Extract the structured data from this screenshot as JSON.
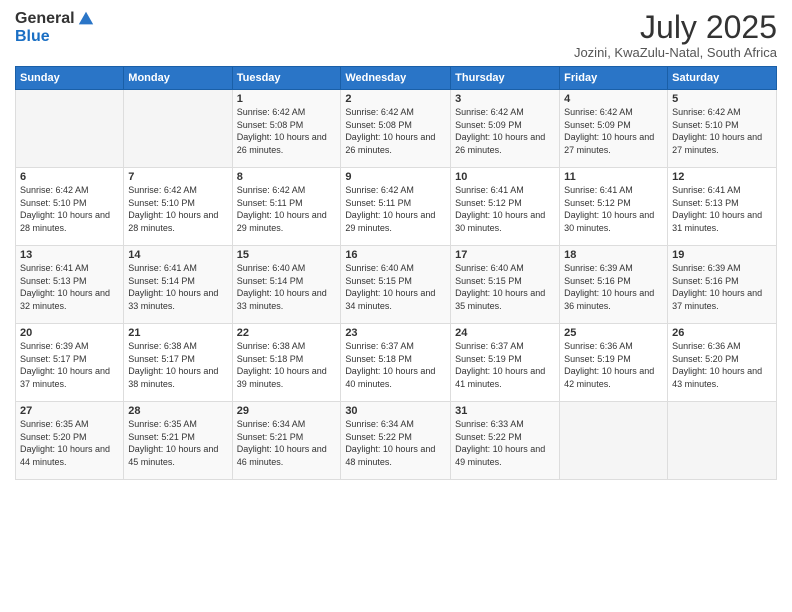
{
  "header": {
    "logo_general": "General",
    "logo_blue": "Blue",
    "title": "July 2025",
    "location": "Jozini, KwaZulu-Natal, South Africa"
  },
  "days_of_week": [
    "Sunday",
    "Monday",
    "Tuesday",
    "Wednesday",
    "Thursday",
    "Friday",
    "Saturday"
  ],
  "weeks": [
    [
      {
        "day": "",
        "sunrise": "",
        "sunset": "",
        "daylight": ""
      },
      {
        "day": "",
        "sunrise": "",
        "sunset": "",
        "daylight": ""
      },
      {
        "day": "1",
        "sunrise": "Sunrise: 6:42 AM",
        "sunset": "Sunset: 5:08 PM",
        "daylight": "Daylight: 10 hours and 26 minutes."
      },
      {
        "day": "2",
        "sunrise": "Sunrise: 6:42 AM",
        "sunset": "Sunset: 5:08 PM",
        "daylight": "Daylight: 10 hours and 26 minutes."
      },
      {
        "day": "3",
        "sunrise": "Sunrise: 6:42 AM",
        "sunset": "Sunset: 5:09 PM",
        "daylight": "Daylight: 10 hours and 26 minutes."
      },
      {
        "day": "4",
        "sunrise": "Sunrise: 6:42 AM",
        "sunset": "Sunset: 5:09 PM",
        "daylight": "Daylight: 10 hours and 27 minutes."
      },
      {
        "day": "5",
        "sunrise": "Sunrise: 6:42 AM",
        "sunset": "Sunset: 5:10 PM",
        "daylight": "Daylight: 10 hours and 27 minutes."
      }
    ],
    [
      {
        "day": "6",
        "sunrise": "Sunrise: 6:42 AM",
        "sunset": "Sunset: 5:10 PM",
        "daylight": "Daylight: 10 hours and 28 minutes."
      },
      {
        "day": "7",
        "sunrise": "Sunrise: 6:42 AM",
        "sunset": "Sunset: 5:10 PM",
        "daylight": "Daylight: 10 hours and 28 minutes."
      },
      {
        "day": "8",
        "sunrise": "Sunrise: 6:42 AM",
        "sunset": "Sunset: 5:11 PM",
        "daylight": "Daylight: 10 hours and 29 minutes."
      },
      {
        "day": "9",
        "sunrise": "Sunrise: 6:42 AM",
        "sunset": "Sunset: 5:11 PM",
        "daylight": "Daylight: 10 hours and 29 minutes."
      },
      {
        "day": "10",
        "sunrise": "Sunrise: 6:41 AM",
        "sunset": "Sunset: 5:12 PM",
        "daylight": "Daylight: 10 hours and 30 minutes."
      },
      {
        "day": "11",
        "sunrise": "Sunrise: 6:41 AM",
        "sunset": "Sunset: 5:12 PM",
        "daylight": "Daylight: 10 hours and 30 minutes."
      },
      {
        "day": "12",
        "sunrise": "Sunrise: 6:41 AM",
        "sunset": "Sunset: 5:13 PM",
        "daylight": "Daylight: 10 hours and 31 minutes."
      }
    ],
    [
      {
        "day": "13",
        "sunrise": "Sunrise: 6:41 AM",
        "sunset": "Sunset: 5:13 PM",
        "daylight": "Daylight: 10 hours and 32 minutes."
      },
      {
        "day": "14",
        "sunrise": "Sunrise: 6:41 AM",
        "sunset": "Sunset: 5:14 PM",
        "daylight": "Daylight: 10 hours and 33 minutes."
      },
      {
        "day": "15",
        "sunrise": "Sunrise: 6:40 AM",
        "sunset": "Sunset: 5:14 PM",
        "daylight": "Daylight: 10 hours and 33 minutes."
      },
      {
        "day": "16",
        "sunrise": "Sunrise: 6:40 AM",
        "sunset": "Sunset: 5:15 PM",
        "daylight": "Daylight: 10 hours and 34 minutes."
      },
      {
        "day": "17",
        "sunrise": "Sunrise: 6:40 AM",
        "sunset": "Sunset: 5:15 PM",
        "daylight": "Daylight: 10 hours and 35 minutes."
      },
      {
        "day": "18",
        "sunrise": "Sunrise: 6:39 AM",
        "sunset": "Sunset: 5:16 PM",
        "daylight": "Daylight: 10 hours and 36 minutes."
      },
      {
        "day": "19",
        "sunrise": "Sunrise: 6:39 AM",
        "sunset": "Sunset: 5:16 PM",
        "daylight": "Daylight: 10 hours and 37 minutes."
      }
    ],
    [
      {
        "day": "20",
        "sunrise": "Sunrise: 6:39 AM",
        "sunset": "Sunset: 5:17 PM",
        "daylight": "Daylight: 10 hours and 37 minutes."
      },
      {
        "day": "21",
        "sunrise": "Sunrise: 6:38 AM",
        "sunset": "Sunset: 5:17 PM",
        "daylight": "Daylight: 10 hours and 38 minutes."
      },
      {
        "day": "22",
        "sunrise": "Sunrise: 6:38 AM",
        "sunset": "Sunset: 5:18 PM",
        "daylight": "Daylight: 10 hours and 39 minutes."
      },
      {
        "day": "23",
        "sunrise": "Sunrise: 6:37 AM",
        "sunset": "Sunset: 5:18 PM",
        "daylight": "Daylight: 10 hours and 40 minutes."
      },
      {
        "day": "24",
        "sunrise": "Sunrise: 6:37 AM",
        "sunset": "Sunset: 5:19 PM",
        "daylight": "Daylight: 10 hours and 41 minutes."
      },
      {
        "day": "25",
        "sunrise": "Sunrise: 6:36 AM",
        "sunset": "Sunset: 5:19 PM",
        "daylight": "Daylight: 10 hours and 42 minutes."
      },
      {
        "day": "26",
        "sunrise": "Sunrise: 6:36 AM",
        "sunset": "Sunset: 5:20 PM",
        "daylight": "Daylight: 10 hours and 43 minutes."
      }
    ],
    [
      {
        "day": "27",
        "sunrise": "Sunrise: 6:35 AM",
        "sunset": "Sunset: 5:20 PM",
        "daylight": "Daylight: 10 hours and 44 minutes."
      },
      {
        "day": "28",
        "sunrise": "Sunrise: 6:35 AM",
        "sunset": "Sunset: 5:21 PM",
        "daylight": "Daylight: 10 hours and 45 minutes."
      },
      {
        "day": "29",
        "sunrise": "Sunrise: 6:34 AM",
        "sunset": "Sunset: 5:21 PM",
        "daylight": "Daylight: 10 hours and 46 minutes."
      },
      {
        "day": "30",
        "sunrise": "Sunrise: 6:34 AM",
        "sunset": "Sunset: 5:22 PM",
        "daylight": "Daylight: 10 hours and 48 minutes."
      },
      {
        "day": "31",
        "sunrise": "Sunrise: 6:33 AM",
        "sunset": "Sunset: 5:22 PM",
        "daylight": "Daylight: 10 hours and 49 minutes."
      },
      {
        "day": "",
        "sunrise": "",
        "sunset": "",
        "daylight": ""
      },
      {
        "day": "",
        "sunrise": "",
        "sunset": "",
        "daylight": ""
      }
    ]
  ]
}
